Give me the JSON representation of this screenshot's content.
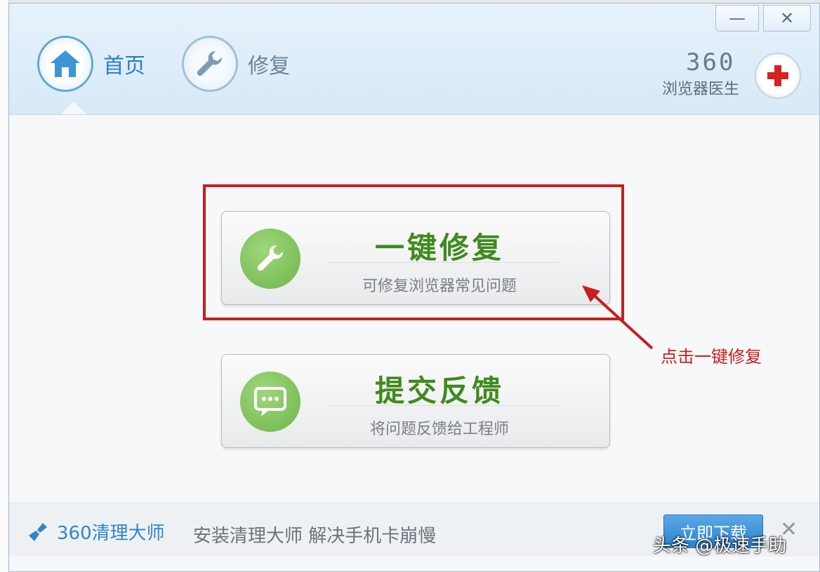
{
  "header": {
    "nav": [
      {
        "label": "首页",
        "icon": "home-icon",
        "active": true
      },
      {
        "label": "修复",
        "icon": "wrench-icon",
        "active": false
      }
    ],
    "window_controls": {
      "minimize": "—",
      "close": "✕"
    },
    "brand": {
      "number": "360",
      "name": "浏览器医生",
      "icon": "red-cross-icon"
    }
  },
  "main": {
    "repair": {
      "title": "一键修复",
      "subtitle": "可修复浏览器常见问题",
      "icon": "wrench-icon"
    },
    "feedback": {
      "title": "提交反馈",
      "subtitle": "将问题反馈给工程师",
      "icon": "chat-bubble-icon"
    },
    "annotation": "点击一键修复",
    "annotation_color": "#c81e1e"
  },
  "footer": {
    "brand_label": "360清理大师",
    "description": "安装清理大师 解决手机卡崩慢",
    "download_label": "立即下载",
    "close": "✕"
  },
  "watermark": "头条 @极速手助",
  "colors": {
    "accent_blue": "#2b7fc2",
    "accent_green": "#3f8a1e",
    "alert_red": "#c81e1e"
  }
}
